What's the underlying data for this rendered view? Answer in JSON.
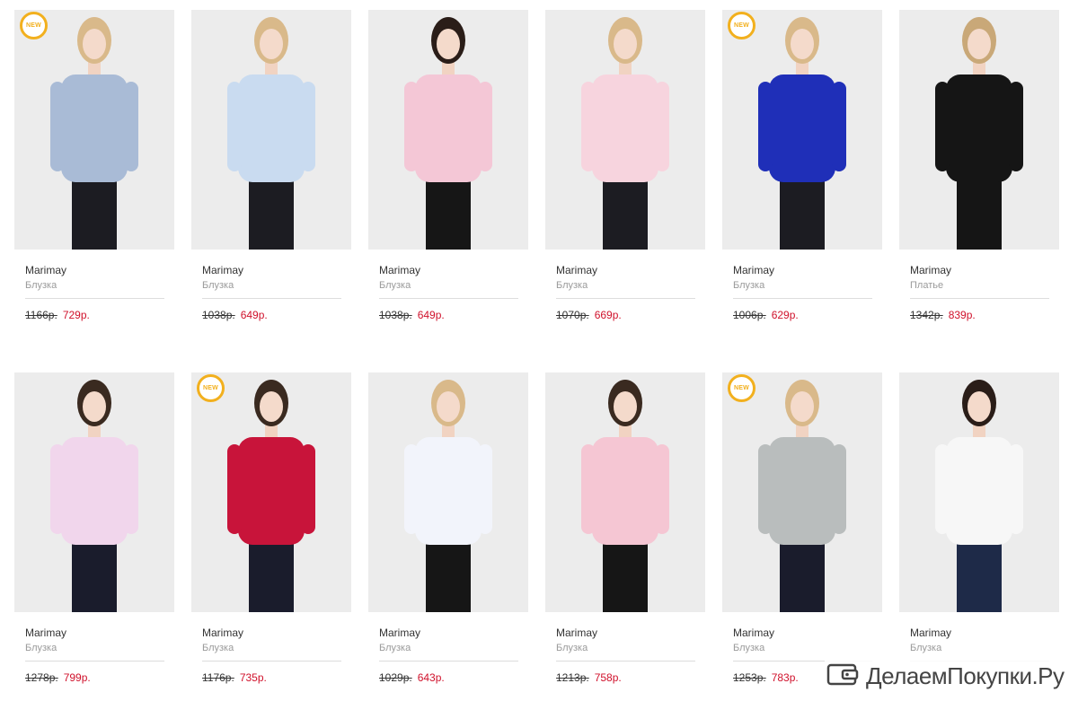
{
  "products": [
    {
      "brand": "Marimay",
      "category": "Блузка",
      "old_price": "1166р.",
      "price": "729р.",
      "badge": "NEW",
      "colors": {
        "top": "#a9bbd6",
        "bottom": "#1c1c22",
        "hair": "#d9b98a"
      }
    },
    {
      "brand": "Marimay",
      "category": "Блузка",
      "old_price": "1038р.",
      "price": "649р.",
      "badge": "",
      "colors": {
        "top": "#c9dbf0",
        "bottom": "#1c1c22",
        "hair": "#d9b98a"
      }
    },
    {
      "brand": "Marimay",
      "category": "Блузка",
      "old_price": "1038р.",
      "price": "649р.",
      "badge": "",
      "colors": {
        "top": "#f4c7d6",
        "bottom": "#161616",
        "hair": "#2a1d18"
      }
    },
    {
      "brand": "Marimay",
      "category": "Блузка",
      "old_price": "1070р.",
      "price": "669р.",
      "badge": "",
      "colors": {
        "top": "#f7d4de",
        "bottom": "#1c1c22",
        "hair": "#d9b98a"
      }
    },
    {
      "brand": "Marimay",
      "category": "Блузка",
      "old_price": "1006р.",
      "price": "629р.",
      "badge": "NEW",
      "colors": {
        "top": "#1f2fb8",
        "bottom": "#1c1c22",
        "hair": "#d9b98a"
      }
    },
    {
      "brand": "Marimay",
      "category": "Платье",
      "old_price": "1342р.",
      "price": "839р.",
      "badge": "",
      "colors": {
        "top": "#151515",
        "bottom": "#151515",
        "hair": "#c9a878"
      }
    },
    {
      "brand": "Marimay",
      "category": "Блузка",
      "old_price": "1278р.",
      "price": "799р.",
      "badge": "",
      "colors": {
        "top": "#f1d6ec",
        "bottom": "#1a1c2c",
        "hair": "#3a2a20"
      }
    },
    {
      "brand": "Marimay",
      "category": "Блузка",
      "old_price": "1176р.",
      "price": "735р.",
      "badge": "NEW",
      "colors": {
        "top": "#c8143a",
        "bottom": "#1a1c2c",
        "hair": "#3a2a20"
      }
    },
    {
      "brand": "Marimay",
      "category": "Блузка",
      "old_price": "1029р.",
      "price": "643р.",
      "badge": "",
      "colors": {
        "top": "#f2f4fb",
        "bottom": "#161616",
        "hair": "#d9b98a"
      }
    },
    {
      "brand": "Marimay",
      "category": "Блузка",
      "old_price": "1213р.",
      "price": "758р.",
      "badge": "",
      "colors": {
        "top": "#f5c6d3",
        "bottom": "#161616",
        "hair": "#3a2a20"
      }
    },
    {
      "brand": "Marimay",
      "category": "Блузка",
      "old_price": "1253р.",
      "price": "783р.",
      "badge": "NEW",
      "colors": {
        "top": "#b9bdbd",
        "bottom": "#1a1c2c",
        "hair": "#d9b98a"
      }
    },
    {
      "brand": "Marimay",
      "category": "Блузка",
      "old_price": "",
      "price": "",
      "badge": "",
      "colors": {
        "top": "#f7f7f7",
        "bottom": "#1e2a48",
        "hair": "#2a1d18"
      }
    }
  ],
  "watermark": {
    "text": "ДелаемПокупки.Ру",
    "icon": "wallet-icon"
  },
  "accent": {
    "badge": "#f2b01e",
    "price": "#d0112b"
  }
}
